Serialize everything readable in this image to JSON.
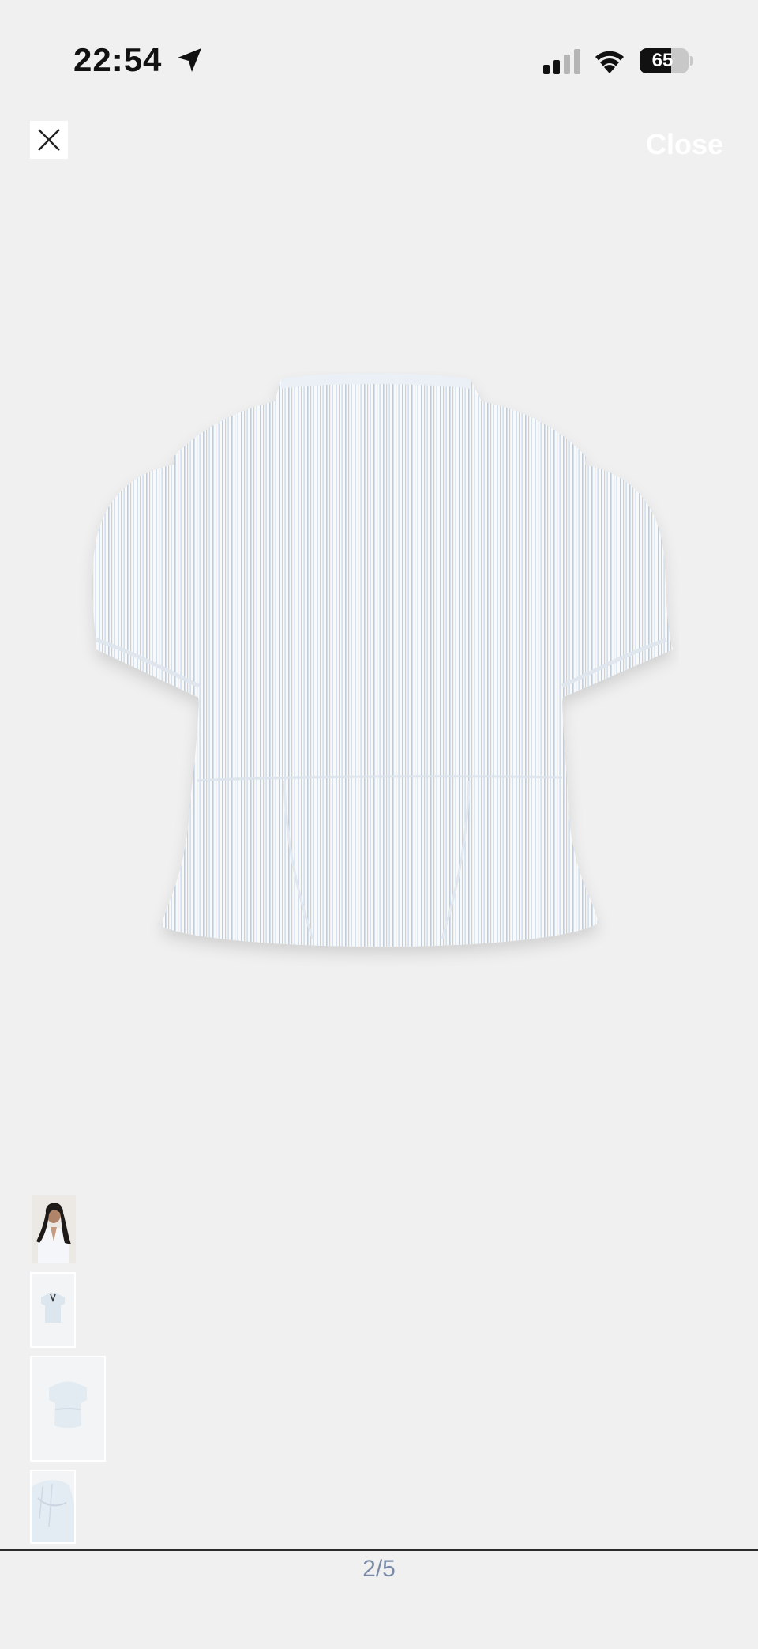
{
  "status_bar": {
    "time": "22:54",
    "battery_percent": "65",
    "battery_level": 0.65,
    "signal_bars_active": 2,
    "signal_bars_total": 4
  },
  "viewer": {
    "close_label": "Close",
    "main_image_icon": "striped-short-sleeve-blouse-back-view",
    "thumbnails": [
      {
        "icon": "model-wearing-blouse-thumbnail"
      },
      {
        "icon": "blouse-front-small-thumbnail"
      },
      {
        "icon": "blouse-back-thumbnail"
      },
      {
        "icon": "blouse-sleeve-detail-thumbnail"
      }
    ],
    "pager": "2/5"
  },
  "colors": {
    "background": "#f0f0f0",
    "pager_text": "#7a8aa6",
    "stripe_blue": "#b9cde3",
    "stripe_beige": "#d8cfbe"
  }
}
